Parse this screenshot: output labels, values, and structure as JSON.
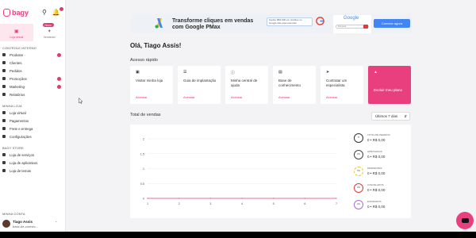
{
  "app": {
    "logo_text": "bagy"
  },
  "colors": {
    "accent": "#ea3f7e",
    "badge": "#e23a6b",
    "banner_cta": "#4285f4"
  },
  "sidebar": {
    "tabs": [
      {
        "label": "Loja virtual",
        "icon": "store-icon",
        "active": true
      },
      {
        "label": "Vendedor",
        "icon": "magic-icon",
        "badge": "Novo",
        "active": false
      }
    ],
    "section_management": "CONTROLE INTERNO",
    "management_items": [
      {
        "label": "Produtos",
        "icon": "tag-icon",
        "chevron": true,
        "dot": true
      },
      {
        "label": "Clientes",
        "icon": "users-icon"
      },
      {
        "label": "Pedidos",
        "icon": "cart-icon"
      },
      {
        "label": "Promoções",
        "icon": "percent-icon",
        "chevron": true,
        "dot": true
      },
      {
        "label": "Marketing",
        "icon": "megaphone-icon",
        "chevron": true,
        "dot": true
      },
      {
        "label": "Relatórios",
        "icon": "chart-icon"
      }
    ],
    "section_store": "MINHA LOJA",
    "store_items": [
      {
        "label": "Loja virtual",
        "icon": "monitor-icon"
      },
      {
        "label": "Pagamentos",
        "icon": "card-icon"
      },
      {
        "label": "Frete e entrega",
        "icon": "truck-icon"
      },
      {
        "label": "Configurações",
        "icon": "gear-icon"
      }
    ],
    "section_bagy_store": "BAGY STORE",
    "bagy_store_items": [
      {
        "label": "Loja de serviços",
        "icon": "briefcase-icon"
      },
      {
        "label": "Loja de aplicativos",
        "icon": "apps-icon"
      },
      {
        "label": "Loja de temas",
        "icon": "palette-icon"
      }
    ],
    "section_account": "MINHA CONTA",
    "account": {
      "name": "Tiago Assis",
      "store": "base-de-conhec..."
    }
  },
  "banner": {
    "title": "Transforme cliques em vendas com Google PMax",
    "card_text": "Ganhe R$1.000 em créditos no Google Ads para anunciar",
    "google_word": "Google",
    "search_placeholder": "Pesquisa",
    "cta": "Comece agora"
  },
  "main": {
    "greeting": "Olá, Tiago Assis!",
    "quick_access_title": "Acesso rápido",
    "quick_cards": [
      {
        "icon": "store-icon",
        "text": "Visitar minha loja",
        "link": "Acessar"
      },
      {
        "icon": "book-icon",
        "text": "Guia de implantação",
        "link": "Acessar"
      },
      {
        "icon": "help-icon",
        "text": "Minha central de ajuda",
        "link": "Acessar"
      },
      {
        "icon": "doc-icon",
        "text": "Base de conhecimento",
        "link": "Acessar"
      },
      {
        "icon": "rocket-icon",
        "text": "Contratar um especialista",
        "link": "Acessar"
      },
      {
        "icon": "upgrade-icon",
        "text": "Evoluir meu plano",
        "link": ""
      }
    ],
    "total_sales_title": "Total de vendas",
    "period_select": "Últimos 7 dias"
  },
  "chart_data": {
    "type": "line",
    "x": [
      1,
      2,
      3,
      4,
      5,
      6,
      7
    ],
    "series": [
      {
        "values": [
          0,
          0,
          0,
          0,
          0,
          0,
          0
        ]
      }
    ],
    "yticks": [
      "2",
      "1.5",
      "1",
      "0.5",
      "0"
    ],
    "ylim": [
      0,
      2
    ],
    "grid": true
  },
  "sales_status": [
    {
      "label": "TOTAL DE PEDIDOS",
      "circle": "",
      "value": "0 • R$ 0,00",
      "color": "#333333"
    },
    {
      "label": "APROVADOS",
      "circle": "0%",
      "value": "0 • R$ 0,00",
      "color": "#444444"
    },
    {
      "label": "PENDENTES",
      "circle": "0%",
      "value": "0 • R$ 0,00",
      "color": "#e6c229"
    },
    {
      "label": "CANCELADOS",
      "circle": "0%",
      "value": "0 • R$ 0,00",
      "color": "#e23a3a"
    },
    {
      "label": "EXPIRADOS",
      "circle": "0%",
      "value": "0 • R$ 0,00",
      "color": "#a86ae0"
    }
  ]
}
